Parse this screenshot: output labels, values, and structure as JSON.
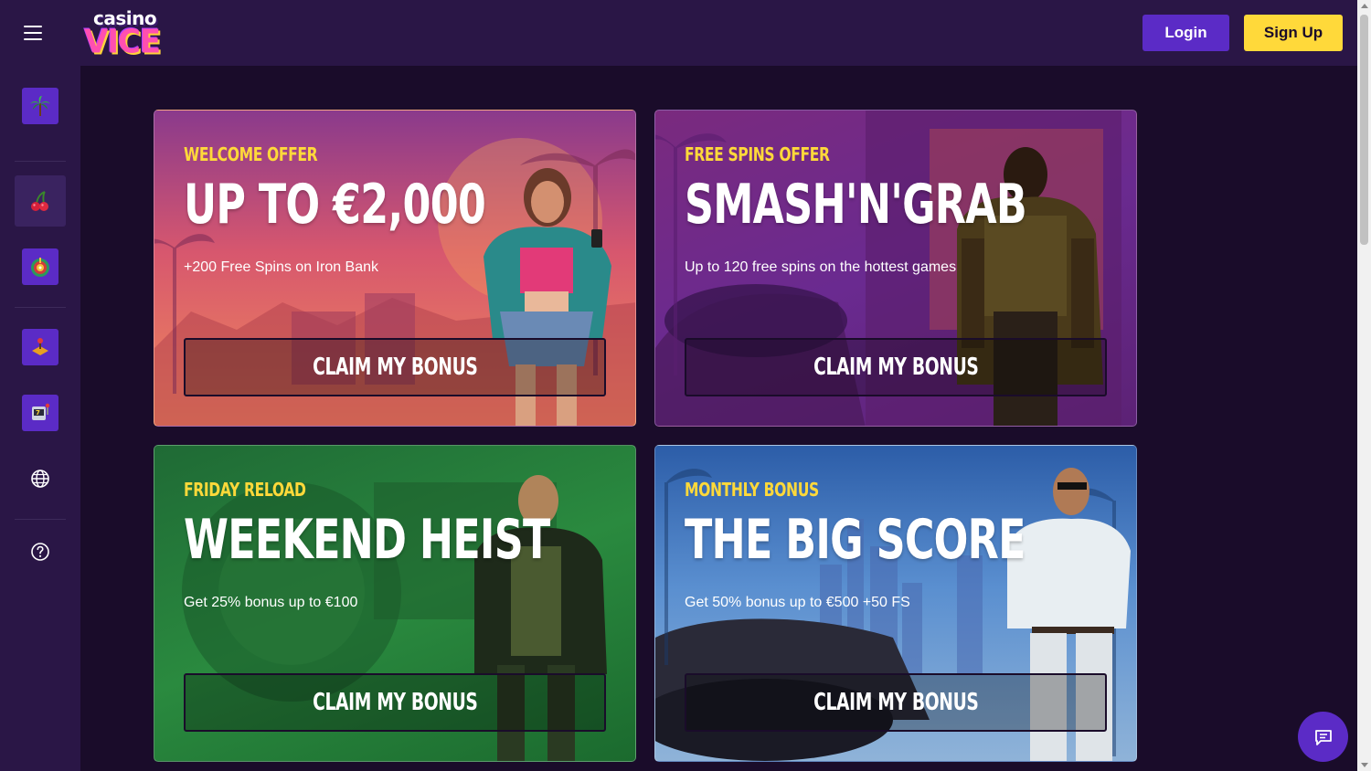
{
  "header": {
    "logo_top": "casino",
    "logo_bottom": "VICE",
    "login_label": "Login",
    "signup_label": "Sign Up"
  },
  "sidebar": {
    "items": [
      {
        "icon": "palm-tree-icon"
      },
      {
        "icon": "cherries-icon"
      },
      {
        "icon": "roulette-icon"
      },
      {
        "icon": "joystick-icon"
      },
      {
        "icon": "slot-machine-icon"
      },
      {
        "icon": "globe-icon"
      },
      {
        "icon": "help-icon"
      }
    ]
  },
  "cards": [
    {
      "tag": "WELCOME OFFER",
      "title": "UP TO €2,000",
      "subtitle": "+200 Free Spins on Iron Bank",
      "button": "CLAIM MY BONUS"
    },
    {
      "tag": "FREE SPINS OFFER",
      "title": "SMASH'N'GRAB",
      "subtitle": "Up to 120 free spins on the hottest games",
      "button": "CLAIM MY BONUS"
    },
    {
      "tag": "FRIDAY RELOAD",
      "title": "WEEKEND HEIST",
      "subtitle": "Get 25% bonus up to €100",
      "button": "CLAIM MY BONUS"
    },
    {
      "tag": "MONTHLY BONUS",
      "title": "THE BIG SCORE",
      "subtitle": "Get 50% bonus up to €500 +50 FS",
      "button": "CLAIM MY BONUS"
    }
  ],
  "colors": {
    "accent": "#5b2bc6",
    "signup": "#ffd93a",
    "background": "#1a0c2a",
    "header": "#2a1646",
    "tag": "#ffd93a"
  },
  "chat": {
    "icon": "chat-icon"
  }
}
